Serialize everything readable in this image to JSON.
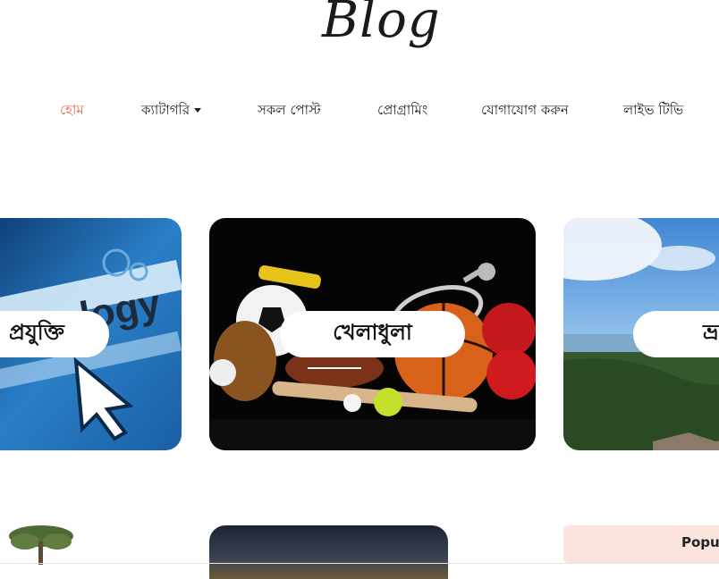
{
  "site": {
    "logo_text": "Blog"
  },
  "nav": {
    "items": [
      {
        "label": "হোম",
        "active": true
      },
      {
        "label": "ক্যাটাগরি",
        "has_dropdown": true
      },
      {
        "label": "সকল পোস্ট"
      },
      {
        "label": "প্রোগ্রামিং"
      },
      {
        "label": "যোগাযোগ করুন"
      },
      {
        "label": "লাইভ টিভি"
      }
    ]
  },
  "categories": [
    {
      "label": "প্রযুক্তি",
      "image_text": "logy"
    },
    {
      "label": "খেলাধুলা"
    },
    {
      "label": "ভ্র"
    }
  ],
  "sidebar": {
    "popular_heading": "Popul"
  },
  "colors": {
    "accent": "#e1694f",
    "popular_bg": "#fbe4dd"
  }
}
